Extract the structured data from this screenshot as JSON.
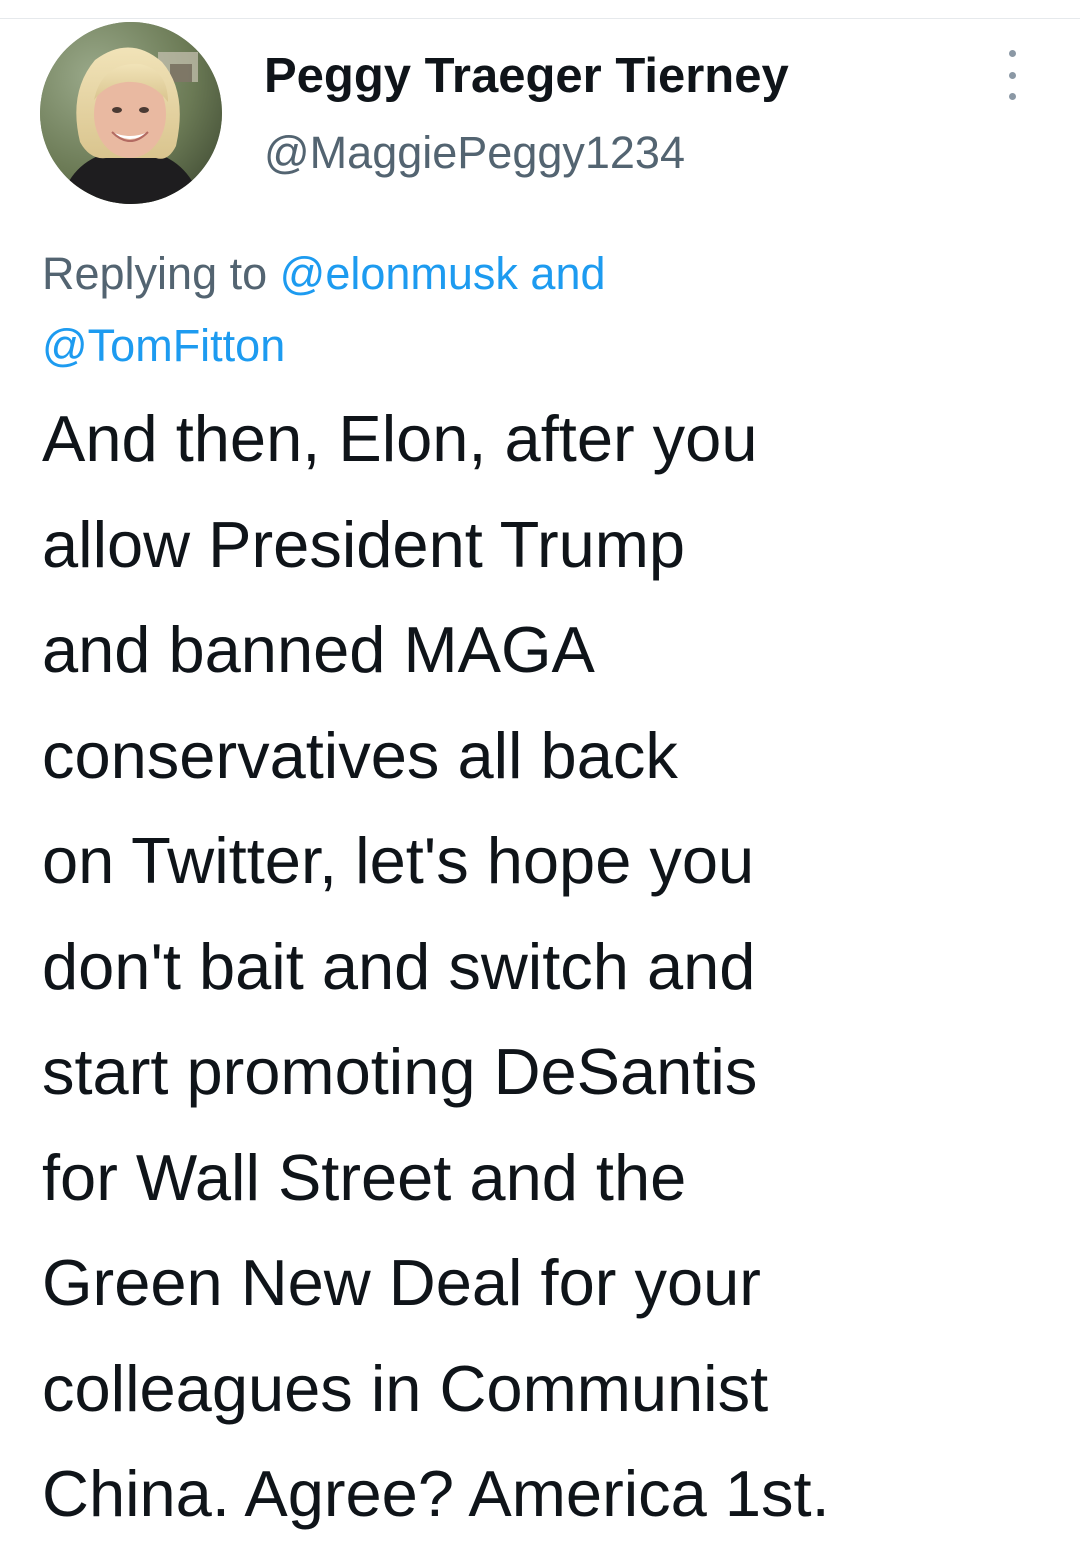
{
  "tweet": {
    "author": {
      "name": "Peggy Traeger Tierney",
      "handle": "@MaggiePeggy1234",
      "avatar_icon": "profile-photo"
    },
    "reply": {
      "prefix": "Replying to ",
      "mention_1": "@elonmusk",
      "conjunction": " and",
      "mention_2": "@TomFitton"
    },
    "text_lines": [
      "And then, Elon, after you",
      "allow President Trump",
      "and banned MAGA",
      "conservatives all back",
      "on Twitter, let's hope you",
      "don't bait and switch and",
      "start promoting DeSantis",
      "for Wall Street and the",
      "Green New Deal for your",
      "colleagues in Communist",
      "China. Agree? America 1st."
    ],
    "more_icon": "more-options-icon"
  },
  "colors": {
    "text": "#0f1419",
    "secondary": "#536471",
    "link": "#1d9bf0"
  }
}
